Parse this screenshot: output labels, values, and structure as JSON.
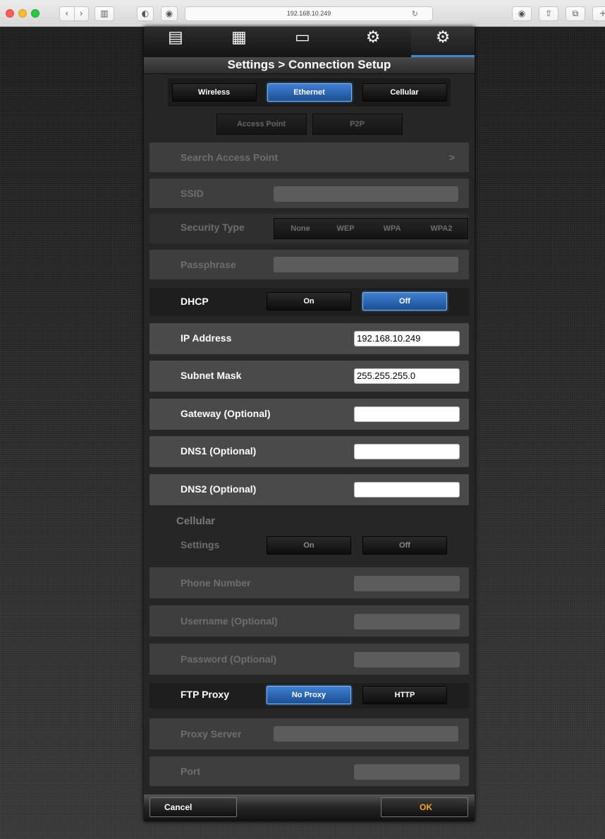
{
  "browser": {
    "url": "192.168.10.249",
    "icons": [
      "back-icon",
      "forward-icon",
      "sidebar-icon",
      "reader-icon",
      "extension-icon",
      "reload-icon",
      "downloads-icon",
      "share-icon",
      "tabs-icon"
    ]
  },
  "toolbar": {
    "icons": [
      "edit-icon",
      "export-icon",
      "monitor-icon",
      "camera-settings-icon",
      "gear-icon"
    ],
    "active": "gear-icon"
  },
  "title": "Settings > Connection Setup",
  "tabs": [
    {
      "label": "Wireless",
      "selected": false
    },
    {
      "label": "Ethernet",
      "selected": true
    },
    {
      "label": "Cellular",
      "selected": false
    }
  ],
  "wireless": {
    "subtabs": [
      "Access Point",
      "P2P"
    ],
    "search_label": "Search Access Point",
    "search_chevron": ">",
    "ssid_label": "SSID",
    "ssid_value": "",
    "security_label": "Security Type",
    "security_options": [
      "None",
      "WEP",
      "WPA",
      "WPA2"
    ],
    "passphrase_label": "Passphrase",
    "passphrase_value": ""
  },
  "dhcp": {
    "label": "DHCP",
    "on_label": "On",
    "off_label": "Off",
    "selected": "off"
  },
  "ethernet": {
    "ip_label": "IP Address",
    "ip_value": "192.168.10.249",
    "subnet_label": "Subnet Mask",
    "subnet_value": "255.255.255.0",
    "gateway_label": "Gateway (Optional)",
    "gateway_value": "",
    "dns1_label": "DNS1 (Optional)",
    "dns1_value": "",
    "dns2_label": "DNS2 (Optional)",
    "dns2_value": ""
  },
  "cellular": {
    "section_label": "Cellular",
    "settings_label": "Settings",
    "on_label": "On",
    "off_label": "Off",
    "phone_label": "Phone Number",
    "phone_value": "",
    "username_label": "Username (Optional)",
    "username_value": "",
    "password_label": "Password (Optional)",
    "password_value": ""
  },
  "ftp": {
    "label": "FTP Proxy",
    "no_proxy_label": "No Proxy",
    "http_label": "HTTP",
    "selected": "no_proxy",
    "server_label": "Proxy Server",
    "server_value": "",
    "port_label": "Port",
    "port_value": ""
  },
  "footer": {
    "cancel_label": "Cancel",
    "ok_label": "OK",
    "ok_color": "#f5a623"
  }
}
